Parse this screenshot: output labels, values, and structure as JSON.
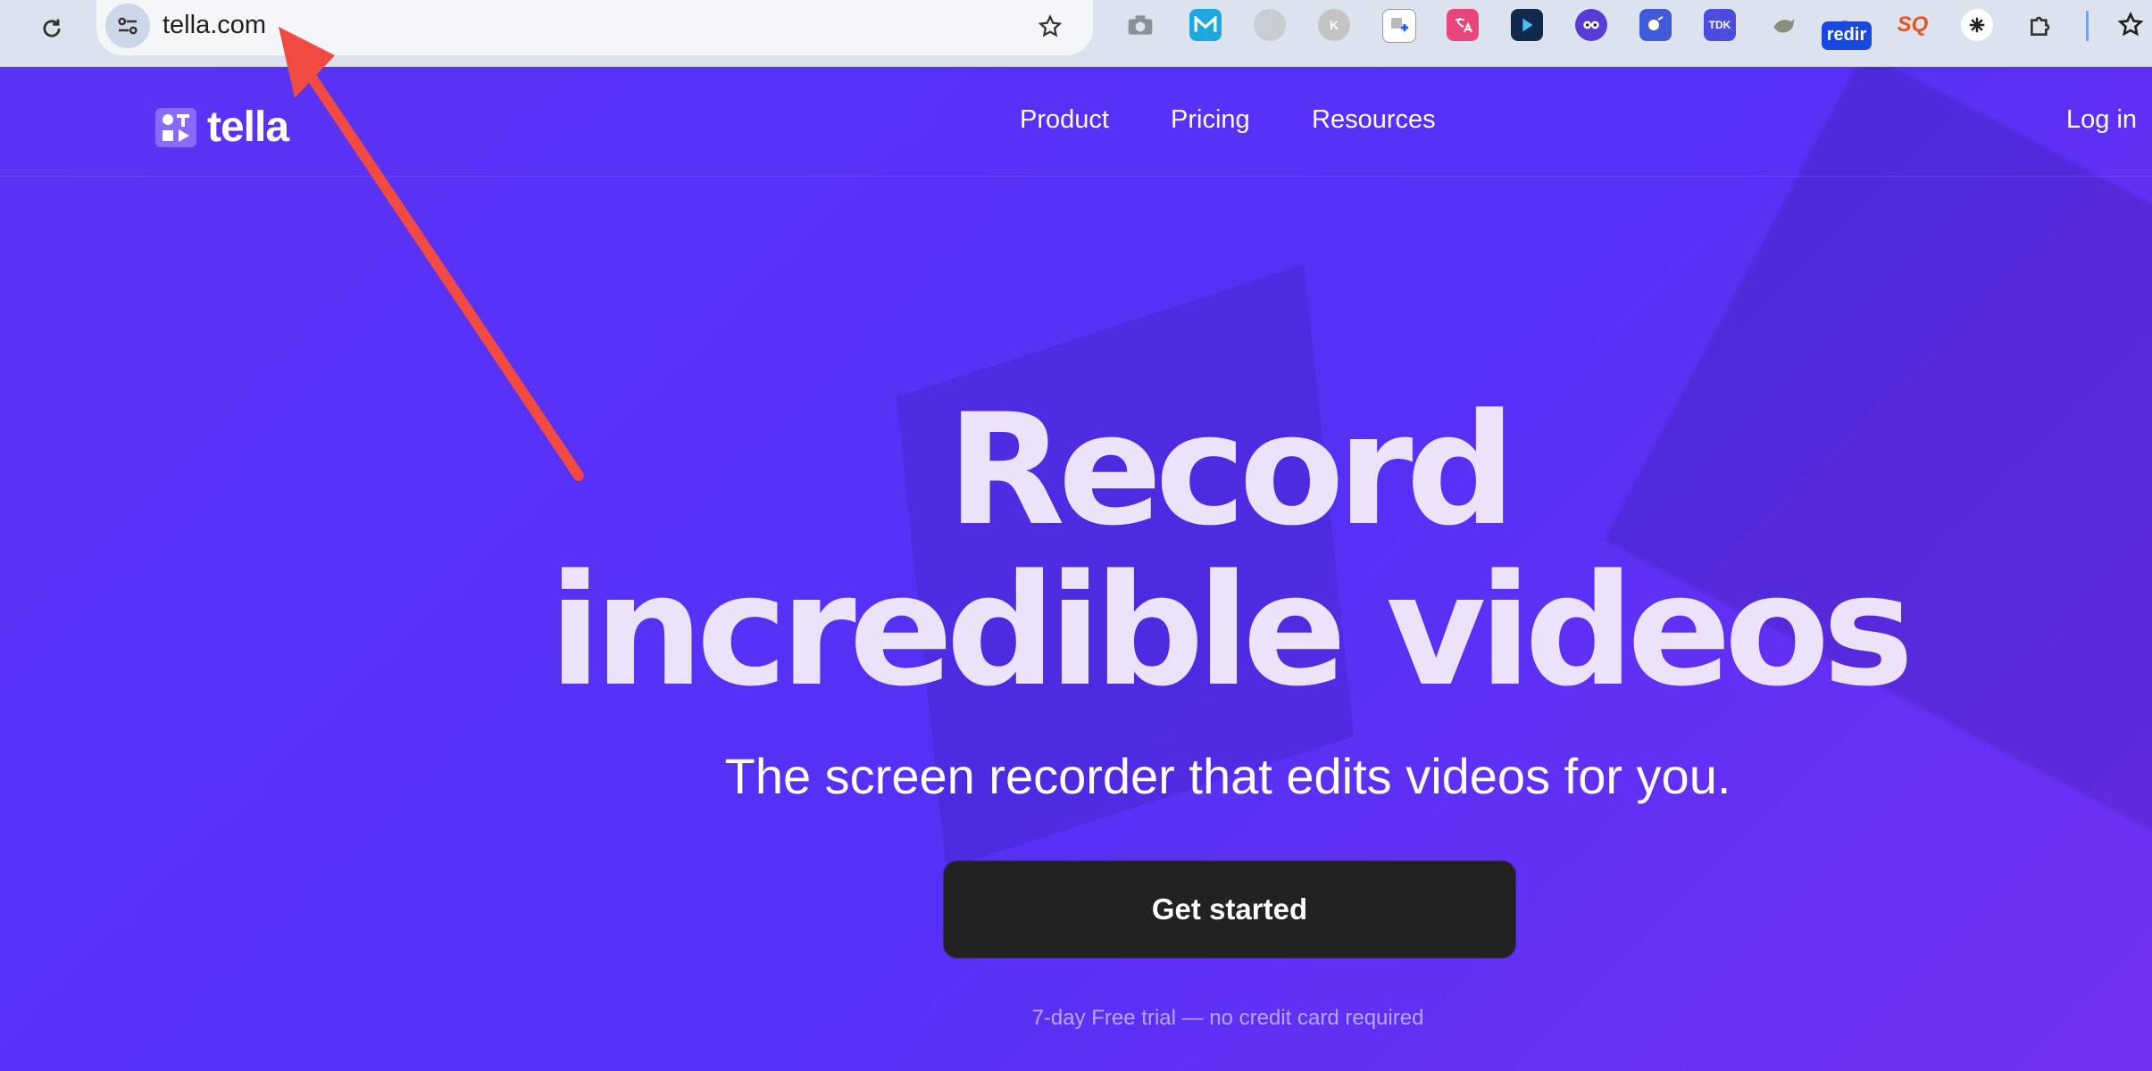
{
  "browser": {
    "url": "tella.com",
    "extension_badge": "redir",
    "extension_labels": {
      "tdk": "TDK",
      "sq": "SQ"
    }
  },
  "site": {
    "logo_text": "tella",
    "nav": [
      "Product",
      "Pricing",
      "Resources"
    ],
    "login": "Log in"
  },
  "hero": {
    "title_line1": "Record",
    "title_line2": "incredible videos",
    "subtitle": "The screen recorder that edits videos for you.",
    "cta": "Get started",
    "note": "7-day Free trial — no credit card required"
  },
  "colors": {
    "page_bg": "#5530f5",
    "cta_bg": "#222222",
    "annotation_arrow": "#f04a43"
  },
  "icons": {
    "reload": "reload-icon",
    "site_info": "tune-icon",
    "bookmark": "star-icon",
    "extensions": "puzzle-icon"
  }
}
